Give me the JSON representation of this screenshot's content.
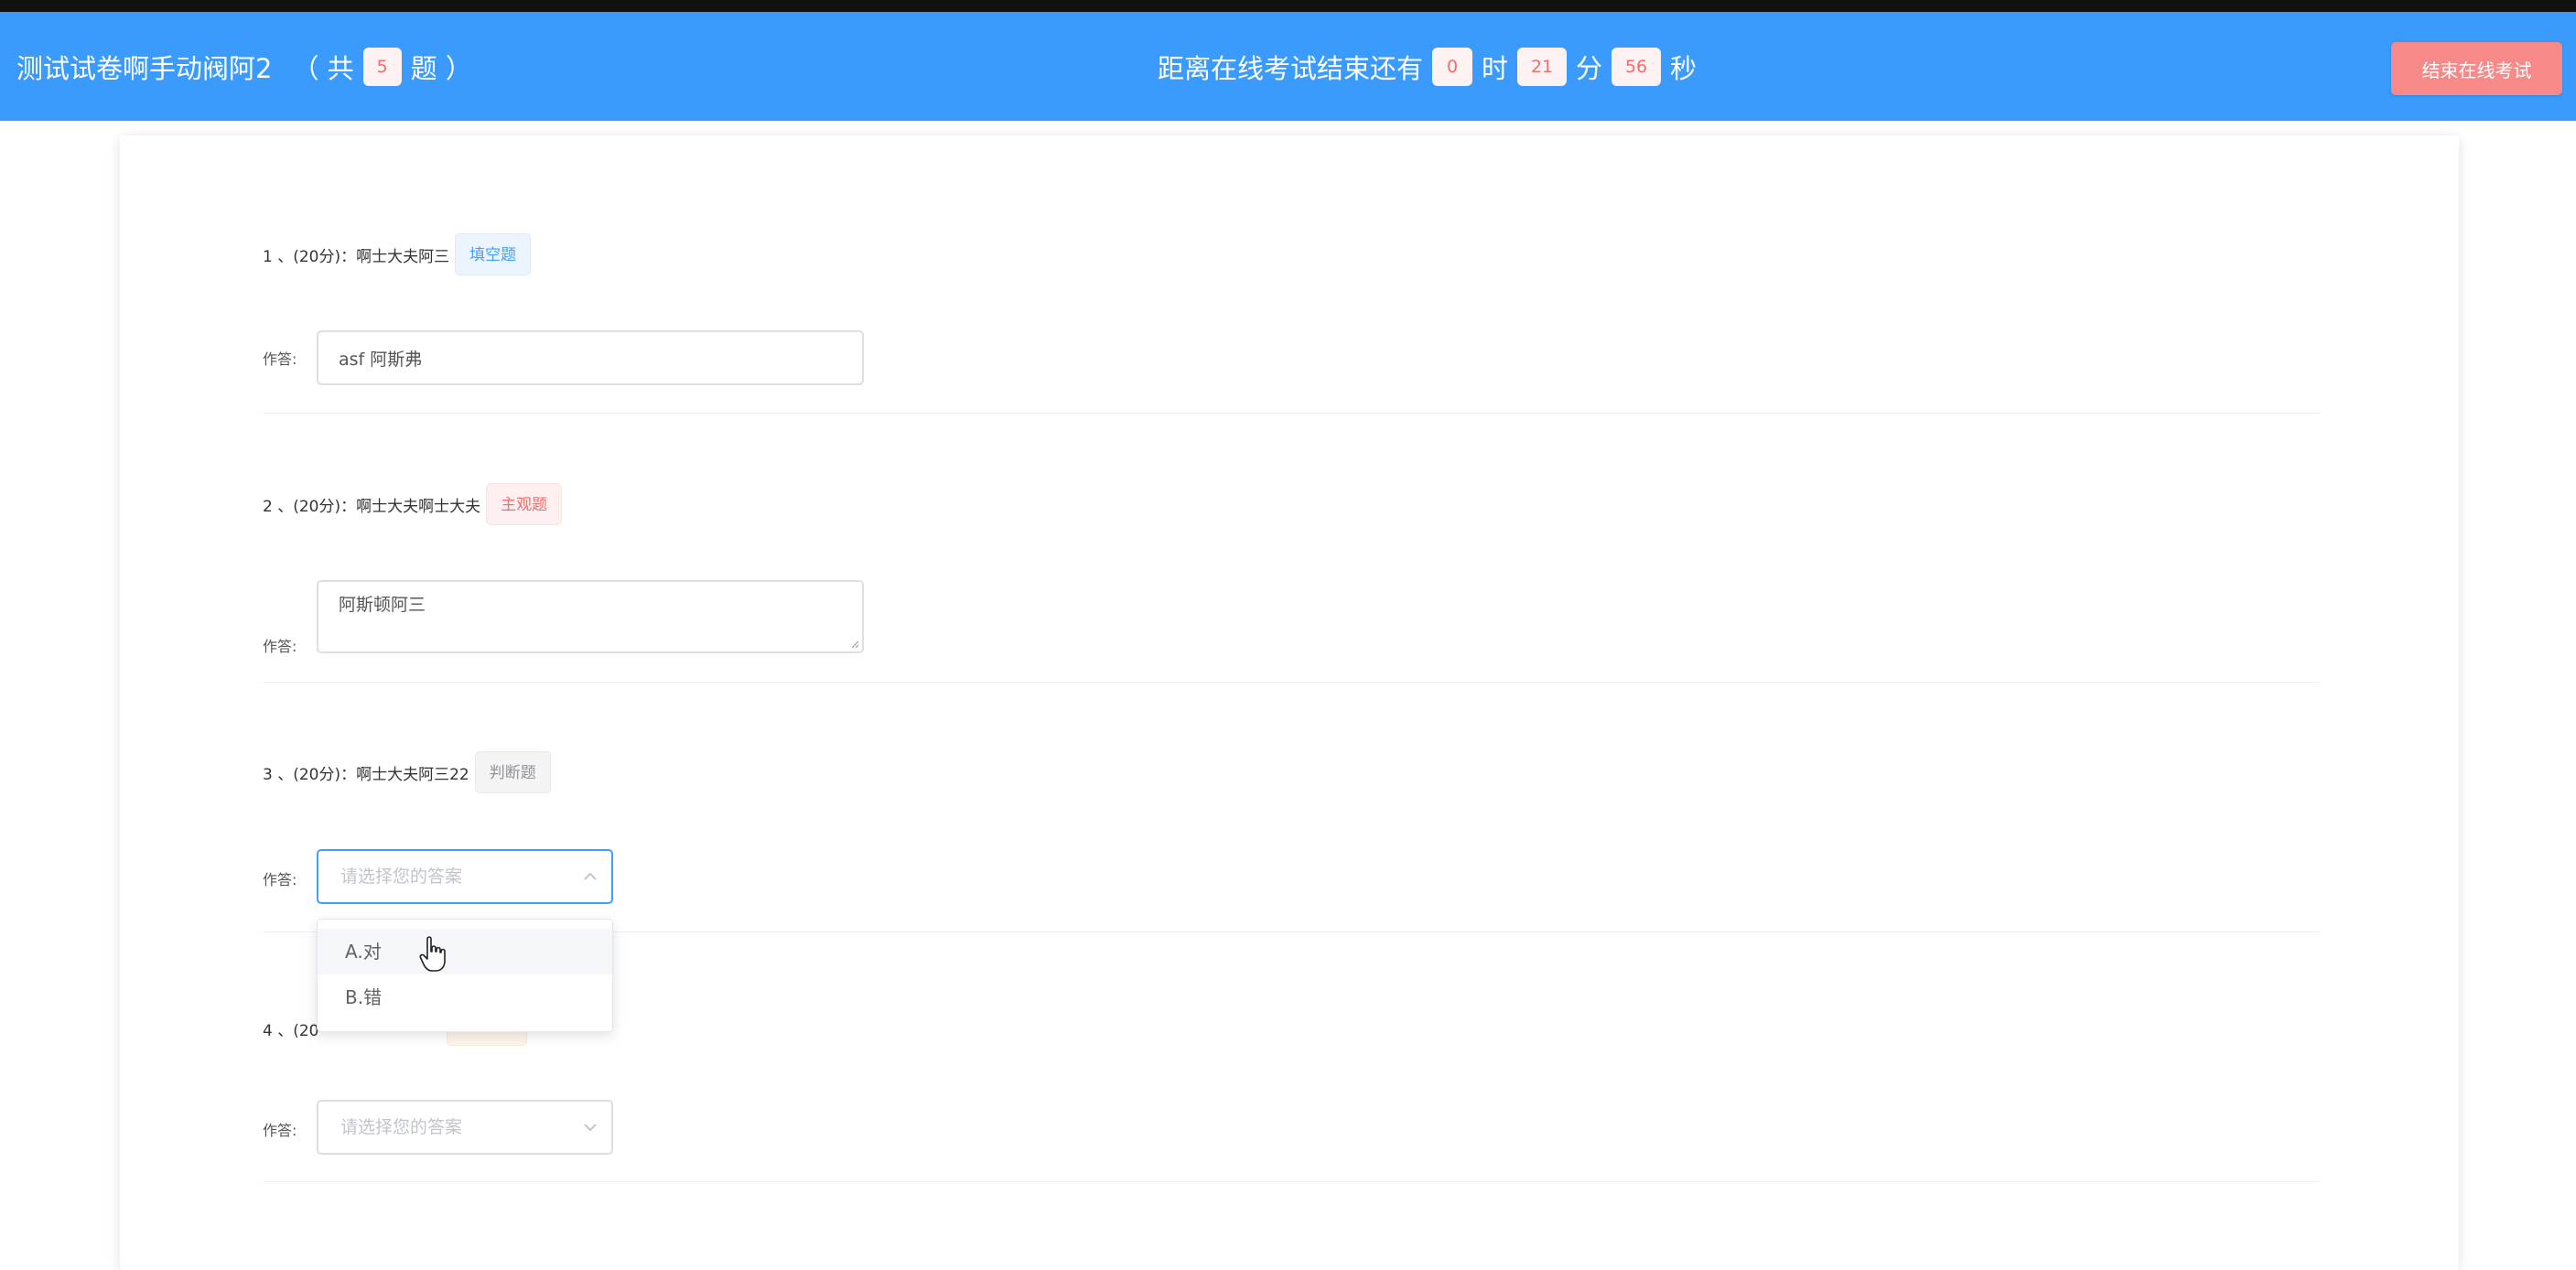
{
  "header": {
    "exam_title": "测试试卷啊手动阀阿2",
    "count_prefix": "（ 共",
    "question_count": "5",
    "count_suffix": "题 ）",
    "timer_prefix": "距离在线考试结束还有",
    "hours": "0",
    "hours_unit": "时",
    "minutes": "21",
    "minutes_unit": "分",
    "seconds": "56",
    "seconds_unit": "秒",
    "end_button": "结束在线考试"
  },
  "answer_label": "作答:",
  "questions": [
    {
      "title": "1 、(20分)：啊士大夫阿三",
      "type_tag": "填空题",
      "answer_value": "asf 阿斯弗"
    },
    {
      "title": "2 、(20分)：啊士大夫啊士大夫",
      "type_tag": "主观题",
      "answer_value": "阿斯顿阿三"
    },
    {
      "title": "3 、(20分)：啊士大夫阿三22",
      "type_tag": "判断题",
      "placeholder": "请选择您的答案",
      "options": [
        "A.对",
        "B.错"
      ]
    },
    {
      "title": "4 、(20",
      "placeholder": "请选择您的答案"
    }
  ],
  "colors": {
    "header_bg": "#3a9bfd",
    "end_button_bg": "#f78989",
    "counter_text": "#f56c6c",
    "select_focus_border": "#409eff"
  },
  "icons": {
    "select_open": "chevron-up-icon",
    "select_closed": "chevron-down-icon",
    "cursor": "hand-pointer-icon"
  }
}
